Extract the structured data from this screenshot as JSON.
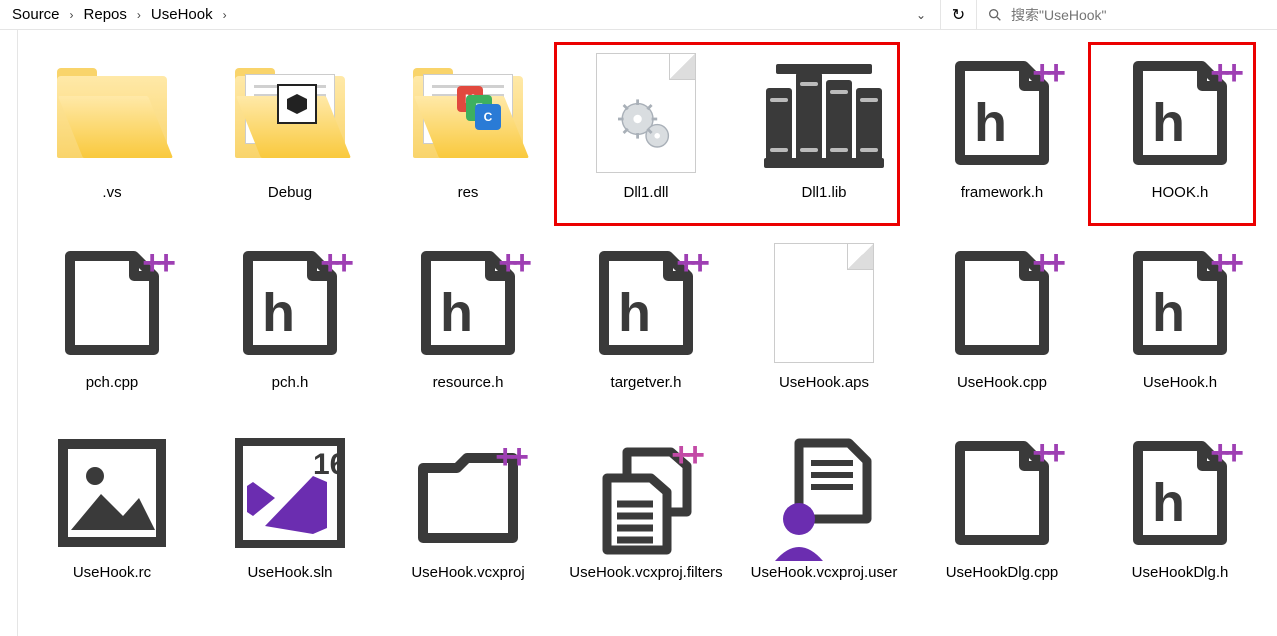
{
  "breadcrumb": {
    "items": [
      "Source",
      "Repos",
      "UseHook"
    ]
  },
  "search": {
    "placeholder": "搜索\"UseHook\""
  },
  "files": [
    {
      "name": ".vs",
      "icon": "folder"
    },
    {
      "name": "Debug",
      "icon": "folder-3d"
    },
    {
      "name": "res",
      "icon": "folder-res"
    },
    {
      "name": "Dll1.dll",
      "icon": "dll"
    },
    {
      "name": "Dll1.lib",
      "icon": "lib"
    },
    {
      "name": "framework.h",
      "icon": "h-cpp"
    },
    {
      "name": "HOOK.h",
      "icon": "h-cpp"
    },
    {
      "name": "pch.cpp",
      "icon": "cpp"
    },
    {
      "name": "pch.h",
      "icon": "h-cpp"
    },
    {
      "name": "resource.h",
      "icon": "h-cpp"
    },
    {
      "name": "targetver.h",
      "icon": "h-cpp"
    },
    {
      "name": "UseHook.aps",
      "icon": "blank"
    },
    {
      "name": "UseHook.cpp",
      "icon": "cpp"
    },
    {
      "name": "UseHook.h",
      "icon": "h-cpp"
    },
    {
      "name": "UseHook.rc",
      "icon": "image"
    },
    {
      "name": "UseHook.sln",
      "icon": "sln"
    },
    {
      "name": "UseHook.vcxproj",
      "icon": "proj"
    },
    {
      "name": "UseHook.vcxproj.filters",
      "icon": "proj-filters"
    },
    {
      "name": "UseHook.vcxproj.user",
      "icon": "proj-user"
    },
    {
      "name": "UseHookDlg.cpp",
      "icon": "cpp"
    },
    {
      "name": "UseHookDlg.h",
      "icon": "h-cpp"
    }
  ],
  "highlights": [
    {
      "cols": [
        3,
        4
      ],
      "row": 0
    },
    {
      "cols": [
        6,
        6
      ],
      "row": 0
    }
  ]
}
